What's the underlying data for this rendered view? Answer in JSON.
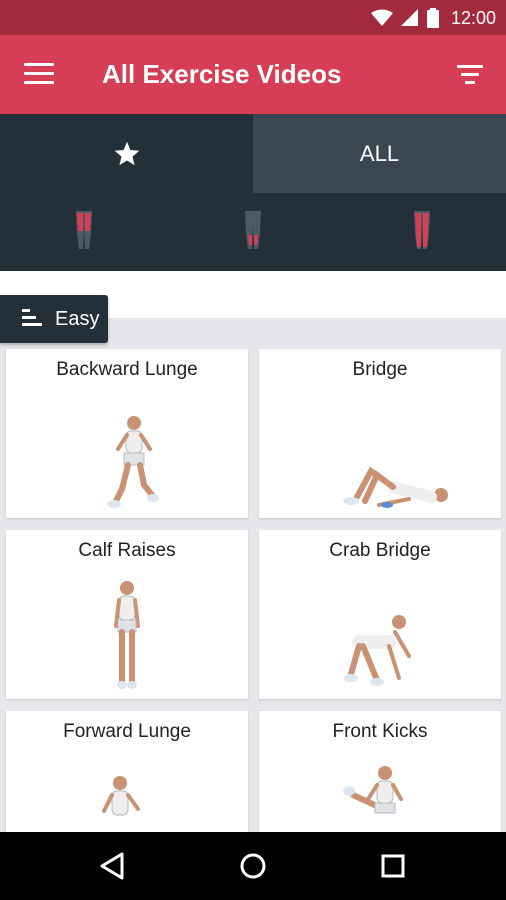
{
  "status_bar": {
    "time": "12:00"
  },
  "app_bar": {
    "title": "All Exercise Videos"
  },
  "tabs": {
    "all_label": "ALL"
  },
  "level": {
    "label": "Easy"
  },
  "exercises": [
    {
      "title": "Backward Lunge"
    },
    {
      "title": "Bridge"
    },
    {
      "title": "Calf Raises"
    },
    {
      "title": "Crab Bridge"
    },
    {
      "title": "Forward Lunge"
    },
    {
      "title": "Front Kicks"
    }
  ],
  "colors": {
    "status_bar": "#a32a3c",
    "app_bar": "#d63e55",
    "tab_dark": "#233039",
    "tab_selected": "#3a4752",
    "muscle_highlight": "#d63e55"
  },
  "icons": {
    "menu": "menu-icon",
    "filter": "filter-icon",
    "favorites": "star-icon",
    "level": "level-bars-icon",
    "nav_back": "back-triangle-icon",
    "nav_home": "home-circle-icon",
    "nav_recents": "recents-square-icon"
  }
}
